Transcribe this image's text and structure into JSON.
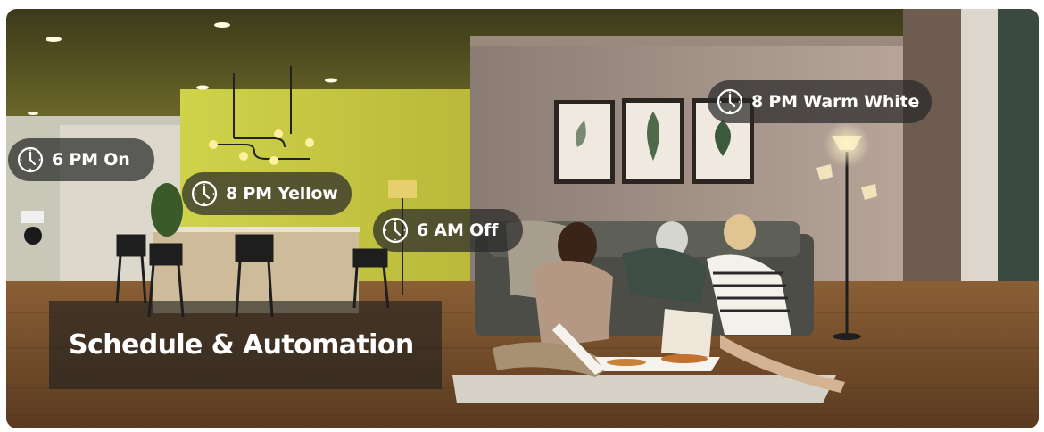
{
  "banner": {
    "title": "Schedule & Automation",
    "schedule_tags": [
      {
        "icon": "clock-icon",
        "label": "6 PM On"
      },
      {
        "icon": "clock-icon",
        "label": "8 PM Yellow"
      },
      {
        "icon": "clock-icon",
        "label": "6 AM Off"
      },
      {
        "icon": "clock-icon",
        "label": "8 PM Warm White"
      }
    ],
    "colors": {
      "pill_background": "#282828",
      "text": "#ffffff",
      "kitchen_light": "#d8d63e",
      "floor": "#6b4a2e"
    }
  }
}
